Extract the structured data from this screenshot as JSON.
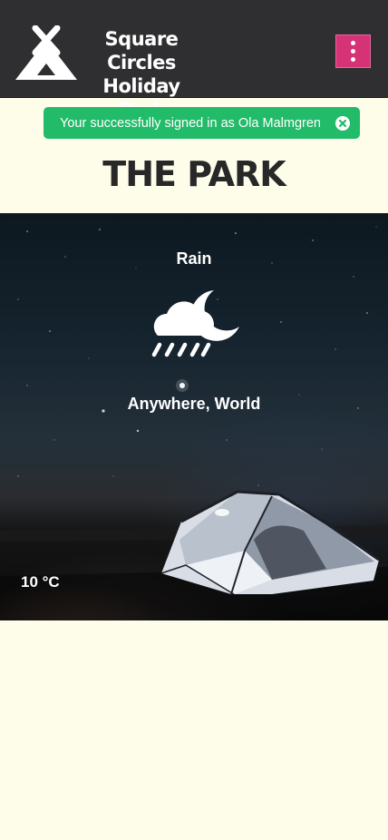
{
  "header": {
    "brand_line1": "Square Circles",
    "brand_line2": "Holiday Park",
    "logo_icon": "teepee-icon",
    "menu_icon": "kebab-menu-icon"
  },
  "alert": {
    "message": "Your successfully signed in as Ola Malmgren",
    "close_icon": "close-circle-icon"
  },
  "page": {
    "title": "THE PARK"
  },
  "weather": {
    "description": "Rain",
    "icon": "rain-night-icon",
    "location": "Anywhere, World",
    "temperature": "10 °C"
  },
  "colors": {
    "header_bg": "#2f2f31",
    "page_bg": "#fdfdea",
    "accent_pink": "#d63377",
    "alert_green": "#22bb6a",
    "title_text": "#282828"
  }
}
